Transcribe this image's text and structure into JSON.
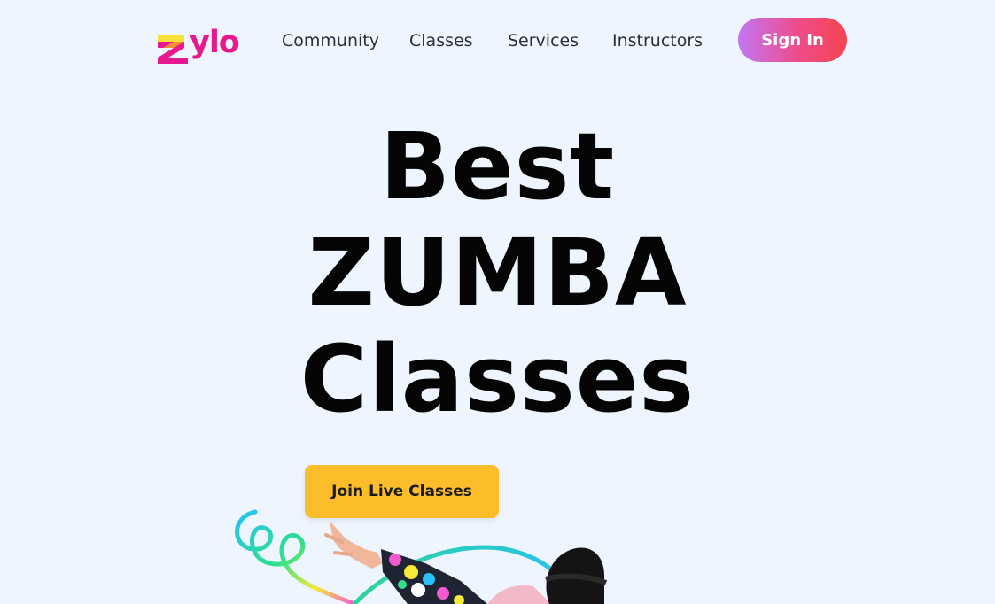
{
  "brand": {
    "name": "ylo",
    "accent": "#e8198f",
    "mark_colors": [
      "#f7e13a",
      "#e8198f"
    ]
  },
  "nav": {
    "items": [
      {
        "label": "Community"
      },
      {
        "label": "Classes"
      },
      {
        "label": "Services"
      },
      {
        "label": "Instructors"
      }
    ],
    "sign_in_label": "Sign In"
  },
  "hero": {
    "title_lines": [
      "Best",
      "ZUMBA",
      "Classes"
    ],
    "cta_label": "Join Live Classes",
    "cta_color": "#fbbd2a"
  },
  "illustration": {
    "subject": "dancer-with-colorful-ribbon"
  },
  "colors": {
    "background": "#eef5ff",
    "text": "#2a2f3a",
    "sign_in_gradient": [
      "#c276f3",
      "#ee4d8b",
      "#f5434f"
    ]
  }
}
